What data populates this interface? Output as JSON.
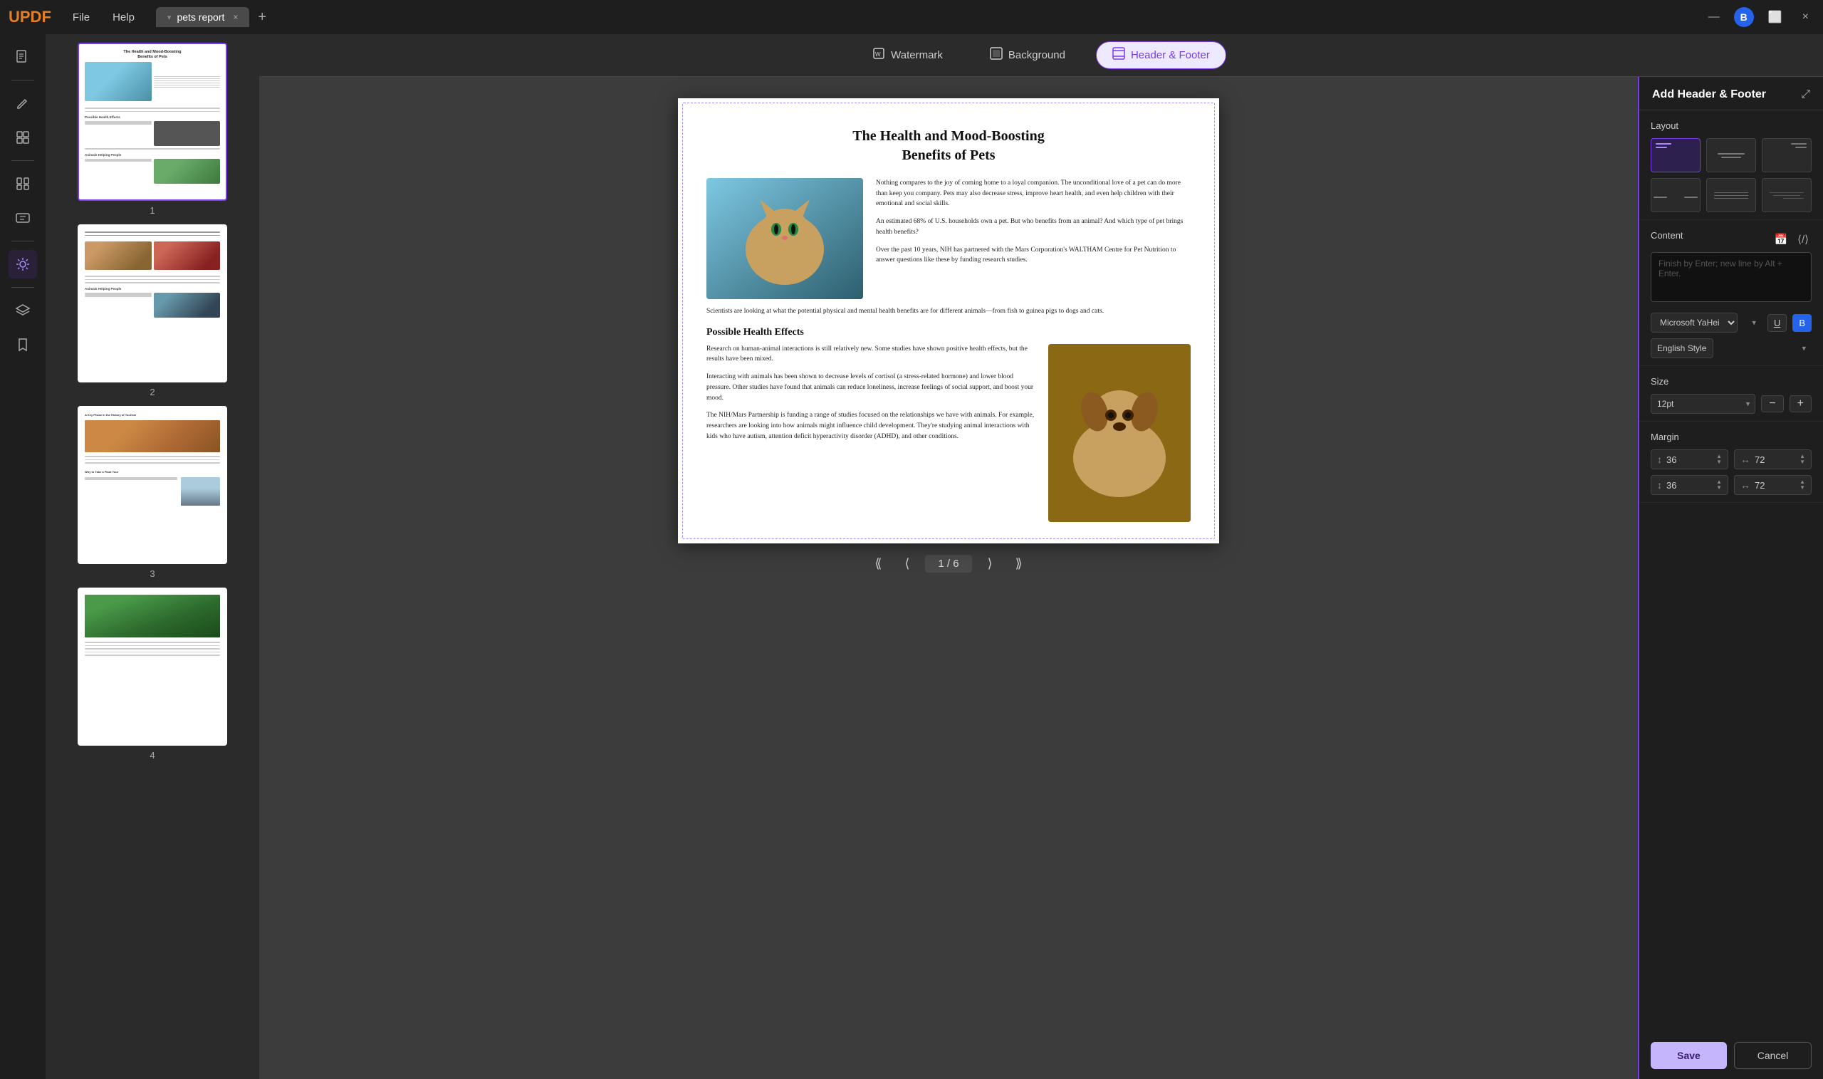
{
  "app": {
    "logo": "UPDF",
    "menu": [
      "File",
      "Help"
    ],
    "tab_name": "pets report",
    "tab_close": "×",
    "tab_add": "+",
    "minimize": "—",
    "maximize": "⬜",
    "close": "×",
    "avatar_initial": "B"
  },
  "toolbar": {
    "watermark_label": "Watermark",
    "background_label": "Background",
    "header_footer_label": "Header & Footer"
  },
  "pages": [
    {
      "number": "1"
    },
    {
      "number": "2"
    },
    {
      "number": "3"
    },
    {
      "number": "4"
    }
  ],
  "pdf": {
    "page_title_line1": "The Health and Mood-Boosting",
    "page_title_line2": "Benefits of Pets",
    "para1": "Nothing compares to the joy of coming home to a loyal companion. The unconditional love of a pet can do more than keep you company. Pets may also decrease stress, improve heart health, and even help children with their emotional and social skills.",
    "para2": "An estimated 68% of U.S. households own a pet. But who benefits from an animal? And which type of pet brings health benefits?",
    "para3": "Over the past 10 years, NIH has partnered with the Mars Corporation's WALTHAM Centre for Pet Nutrition to answer questions like these by funding research studies.",
    "full_row": "Scientists are looking at what the potential physical and mental health benefits are for different animals—from fish to guinea pigs to dogs and cats.",
    "section_title": "Possible Health Effects",
    "body1": "Research on human-animal interactions is still relatively new. Some studies have shown positive health effects, but the results have been mixed.",
    "body2": "Interacting with animals has been shown to decrease levels of cortisol (a stress-related hormone) and lower blood pressure. Other studies have found that animals can reduce loneliness, increase feelings of social support, and boost your mood.",
    "body3": "The NIH/Mars Partnership is funding a range of studies focused on the relationships we have with animals. For example, researchers are looking into how animals might influence child development. They're studying animal interactions with kids who have autism, attention deficit hyperactivity disorder (ADHD), and other conditions."
  },
  "nav": {
    "current_page": "1",
    "total_pages": "6",
    "separator": "/"
  },
  "thumbnail_pages": [
    {
      "label": "1"
    },
    {
      "label": "2"
    },
    {
      "label": "3"
    },
    {
      "label": "4"
    }
  ],
  "right_panel": {
    "title": "Add Header & Footer",
    "layout_label": "Layout",
    "content_label": "Content",
    "content_placeholder": "Finish by Enter; new line by Alt + Enter.",
    "font_name": "Microsoft YaHei",
    "font_style": "English Style",
    "underline_label": "U",
    "bold_label": "B",
    "size_label": "Size",
    "size_value": "12pt",
    "margin_label": "Margin",
    "margin_top_value": "36",
    "margin_right_value": "72",
    "margin_bottom_value": "36",
    "margin_left_value": "72",
    "save_label": "Save",
    "cancel_label": "Cancel",
    "layout_options": [
      {
        "id": "opt1",
        "selected": true
      },
      {
        "id": "opt2"
      },
      {
        "id": "opt3"
      },
      {
        "id": "opt4"
      },
      {
        "id": "opt5"
      },
      {
        "id": "opt6"
      }
    ]
  },
  "sidebar_icons": [
    {
      "name": "document-icon",
      "symbol": "⊟"
    },
    {
      "name": "divider1"
    },
    {
      "name": "annotate-icon",
      "symbol": "✏"
    },
    {
      "name": "edit-icon",
      "symbol": "⊞"
    },
    {
      "name": "divider2"
    },
    {
      "name": "organize-icon",
      "symbol": "⊟"
    },
    {
      "name": "forms-icon",
      "symbol": "⊠"
    },
    {
      "name": "divider3"
    },
    {
      "name": "tools-icon",
      "symbol": "⚙",
      "active": true
    },
    {
      "name": "divider4"
    },
    {
      "name": "layers-icon",
      "symbol": "◈"
    },
    {
      "name": "bookmark-icon",
      "symbol": "🔖"
    }
  ],
  "thumb_page3": {
    "title": "A Key Phase in the History of Tourism",
    "subtitle": "Why to Take a Plant Tour"
  }
}
